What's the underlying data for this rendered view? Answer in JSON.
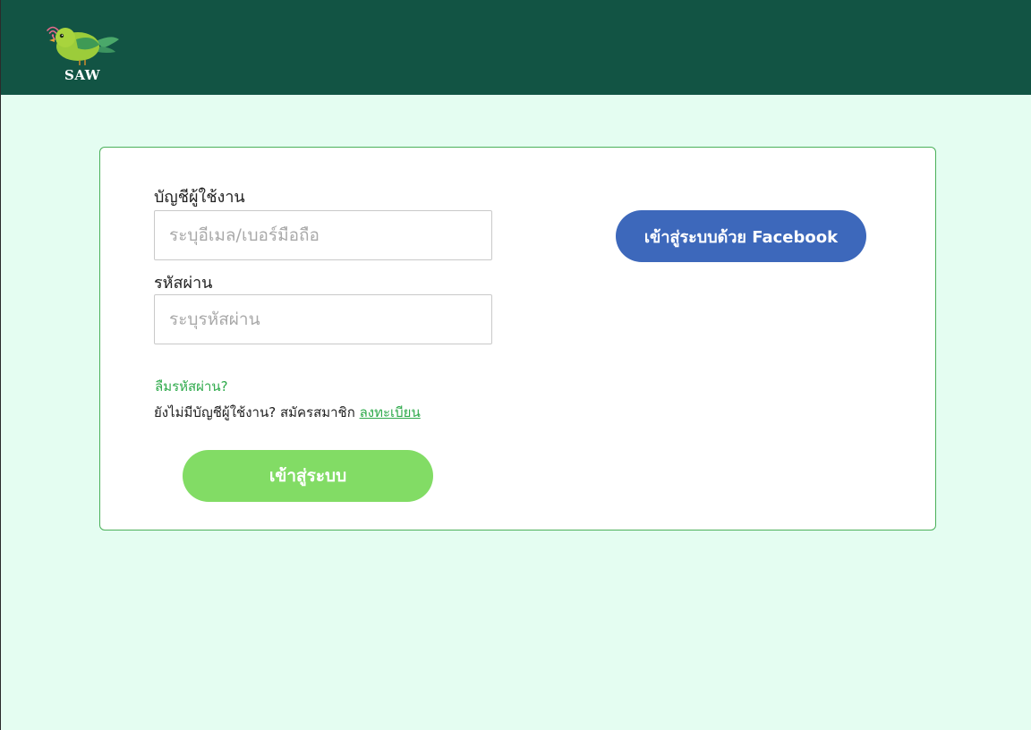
{
  "header": {
    "logo_text": "SAW",
    "bg_color": "#125444"
  },
  "login": {
    "username_label": "บัญชีผู้ใช้งาน",
    "username_placeholder": "ระบุอีเมล/เบอร์มือถือ",
    "password_label": "รหัสผ่าน",
    "password_placeholder": "ระบุรหัสผ่าน",
    "forgot_password": "ลืมรหัสผ่าน?",
    "no_account_text": "ยังไม่มีบัญชีผู้ใช้งาน?  สมัครสมาชิก ",
    "register_link": "ลงทะเบียน",
    "login_button": "เข้าสู่ระบบ",
    "facebook_button": "เข้าสู่ระบบด้วย Facebook"
  },
  "colors": {
    "page_bg": "#e4fdf1",
    "accent_green": "#2eaa4b",
    "login_button": "#82dc65",
    "facebook_button": "#3d68bb",
    "card_border": "#4bb05a"
  },
  "icons": {
    "logo": "bird-logo-icon",
    "signal": "wifi-signal-icon"
  }
}
